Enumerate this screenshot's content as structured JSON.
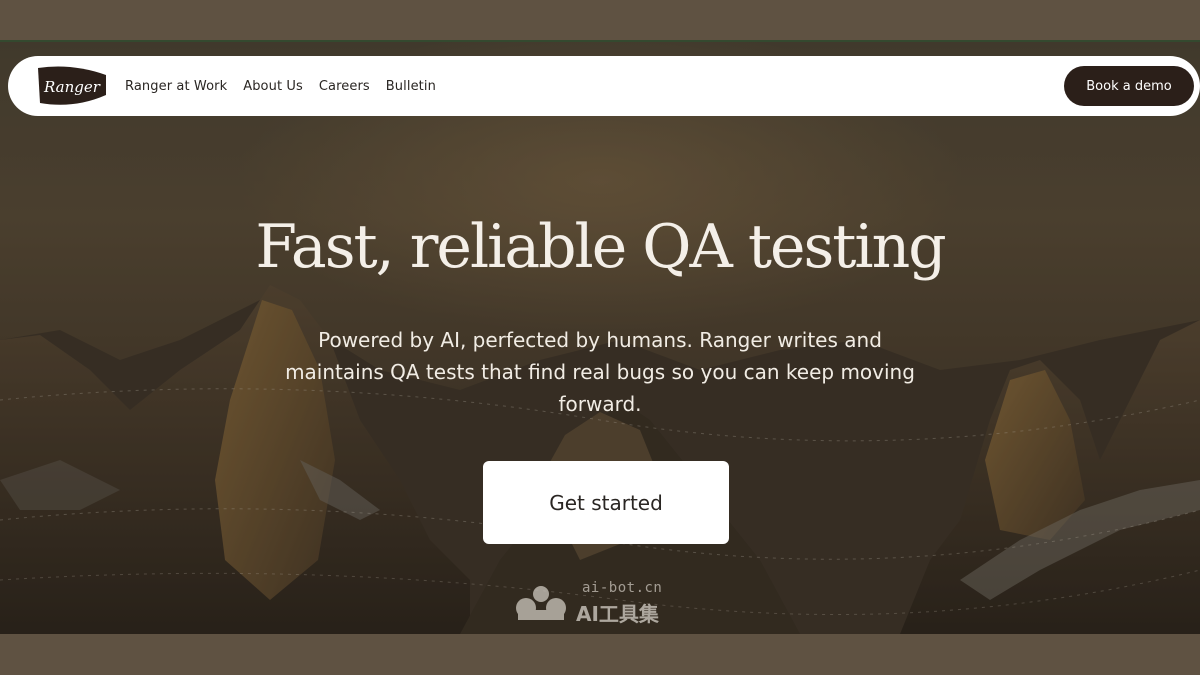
{
  "nav": {
    "logo_text": "Ranger",
    "links": [
      "Ranger at Work",
      "About Us",
      "Careers",
      "Bulletin"
    ],
    "cta_label": "Book a demo"
  },
  "hero": {
    "headline": "Fast, reliable QA testing",
    "subtext": "Powered by AI, perfected by humans. Ranger writes and maintains QA tests that find real bugs so you can keep moving forward.",
    "cta_label": "Get started"
  },
  "watermark": {
    "domain": "ai-bot.cn",
    "brand": "AI工具集"
  },
  "colors": {
    "page_background": "#5f5242",
    "nav_cta_background": "#2b1f19",
    "headline_color": "#f4efe8"
  }
}
